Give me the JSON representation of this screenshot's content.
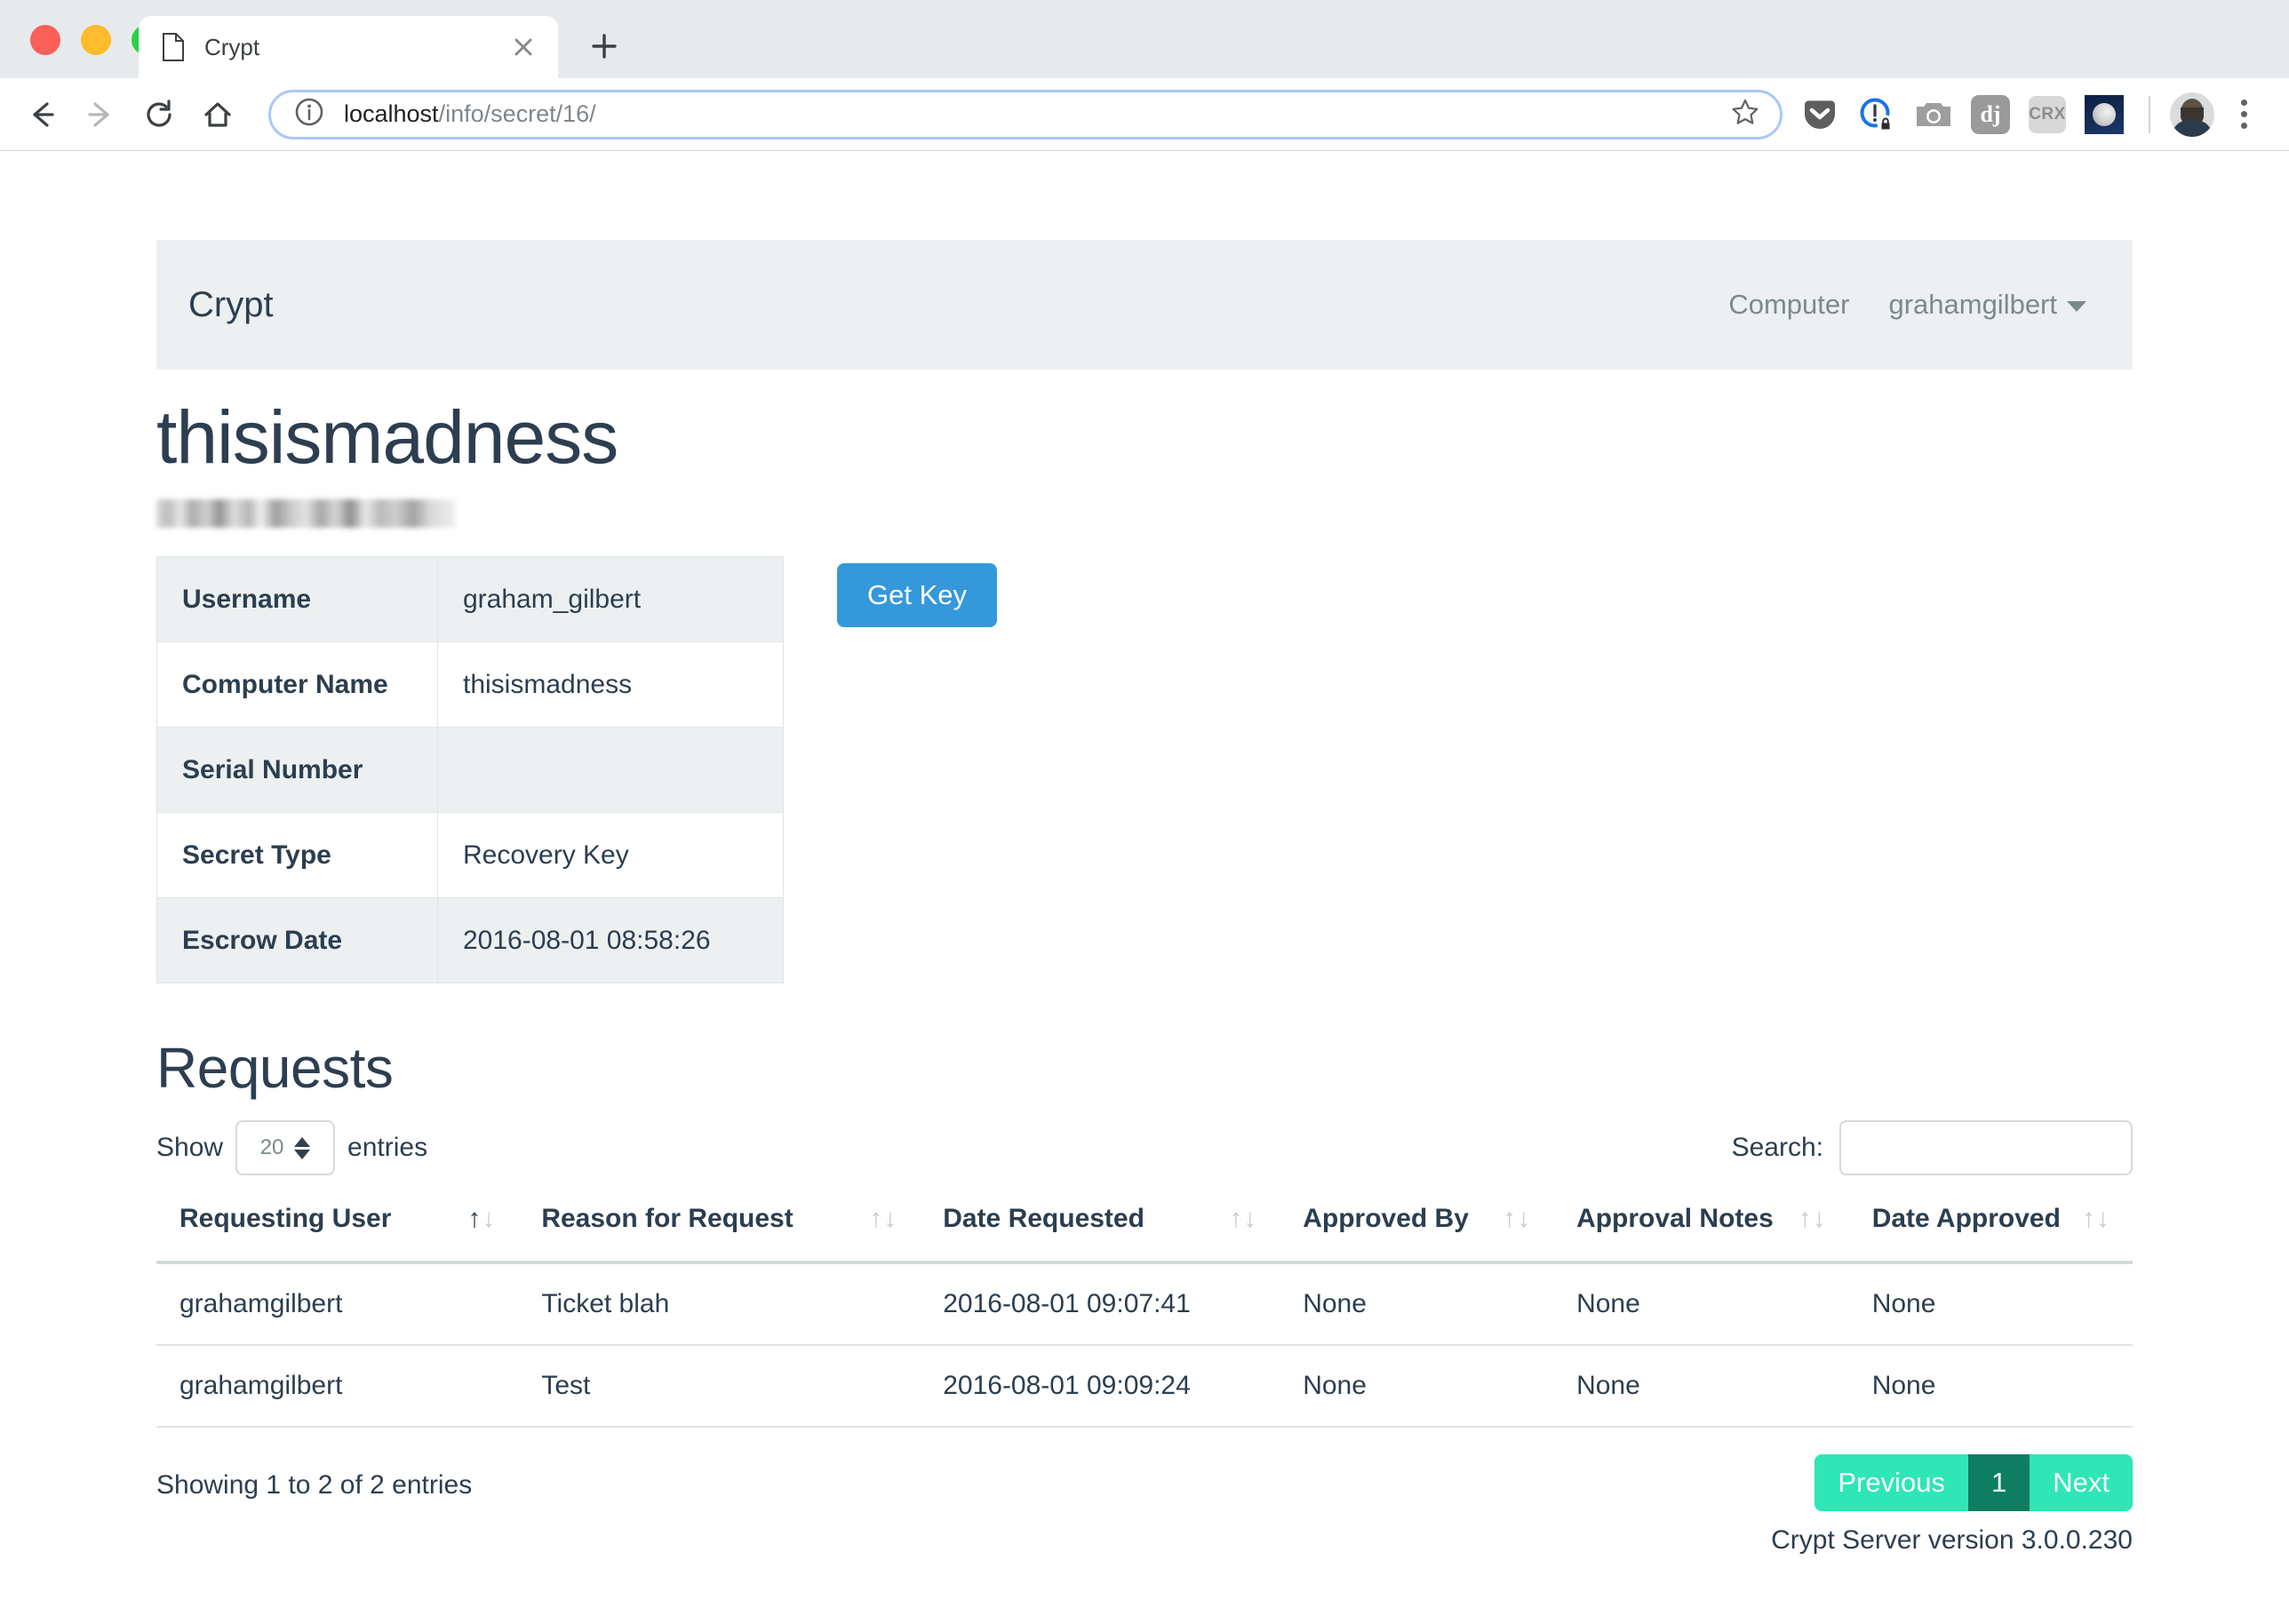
{
  "browser": {
    "tab": {
      "title": "Crypt",
      "favicon": "page-icon",
      "close": "close-icon"
    },
    "new_tab": "plus-icon",
    "nav": {
      "back": "back-arrow-icon",
      "forward": "forward-arrow-icon",
      "reload": "reload-icon",
      "home": "home-icon"
    },
    "omnibox": {
      "security_icon": "info-circle-icon",
      "url_host": "localhost",
      "url_path": "/info/secret/16/",
      "bookmark_icon": "star-icon"
    },
    "extensions": [
      {
        "name": "pocket-extension-icon",
        "label": ""
      },
      {
        "name": "privacy-lock-extension-icon",
        "label": ""
      },
      {
        "name": "camera-extension-icon",
        "label": ""
      },
      {
        "name": "django-extension-icon",
        "label": "dj"
      },
      {
        "name": "crx-extension-icon",
        "label": "CRX"
      },
      {
        "name": "moon-extension-icon",
        "label": ""
      }
    ],
    "profile_avatar": "avatar",
    "menu": "three-dot-menu-icon"
  },
  "navbar": {
    "brand": "Crypt",
    "links": [
      {
        "label": "Computer",
        "has_caret": false
      },
      {
        "label": "grahamgilbert",
        "has_caret": true
      }
    ]
  },
  "page": {
    "title": "thisismadness",
    "subtitle_redacted": true
  },
  "info_table": {
    "rows": [
      {
        "key": "Username",
        "value": "graham_gilbert",
        "redacted": false
      },
      {
        "key": "Computer Name",
        "value": "thisismadness",
        "redacted": false
      },
      {
        "key": "Serial Number",
        "value": "",
        "redacted": true
      },
      {
        "key": "Secret Type",
        "value": "Recovery Key",
        "redacted": false
      },
      {
        "key": "Escrow Date",
        "value": "2016-08-01 08:58:26",
        "redacted": false
      }
    ]
  },
  "actions": {
    "get_key_label": "Get Key",
    "get_key_color": "#3498db"
  },
  "requests": {
    "heading": "Requests",
    "show_label": "Show",
    "entries_value": "20",
    "entries_label": "entries",
    "search_label": "Search:",
    "search_value": "",
    "search_placeholder": "",
    "columns": [
      {
        "label": "Requesting User",
        "sort": "asc"
      },
      {
        "label": "Reason for Request",
        "sort": "none"
      },
      {
        "label": "Date Requested",
        "sort": "none"
      },
      {
        "label": "Approved By",
        "sort": "none"
      },
      {
        "label": "Approval Notes",
        "sort": "none"
      },
      {
        "label": "Date Approved",
        "sort": "none"
      }
    ],
    "rows": [
      {
        "requesting_user": "grahamgilbert",
        "reason": "Ticket blah",
        "date_requested": "2016-08-01 09:07:41",
        "approved_by": "None",
        "approval_notes": "None",
        "date_approved": "None"
      },
      {
        "requesting_user": "grahamgilbert",
        "reason": "Test",
        "date_requested": "2016-08-01 09:09:24",
        "approved_by": "None",
        "approval_notes": "None",
        "date_approved": "None"
      }
    ],
    "showing_text": "Showing 1 to 2 of 2 entries",
    "pagination": {
      "previous": "Previous",
      "pages": [
        "1"
      ],
      "next": "Next",
      "active_page": "1",
      "color": "#2ee6b6",
      "active_color": "#0f7d62"
    }
  },
  "footer": {
    "version_text": "Crypt Server version 3.0.0.230"
  }
}
